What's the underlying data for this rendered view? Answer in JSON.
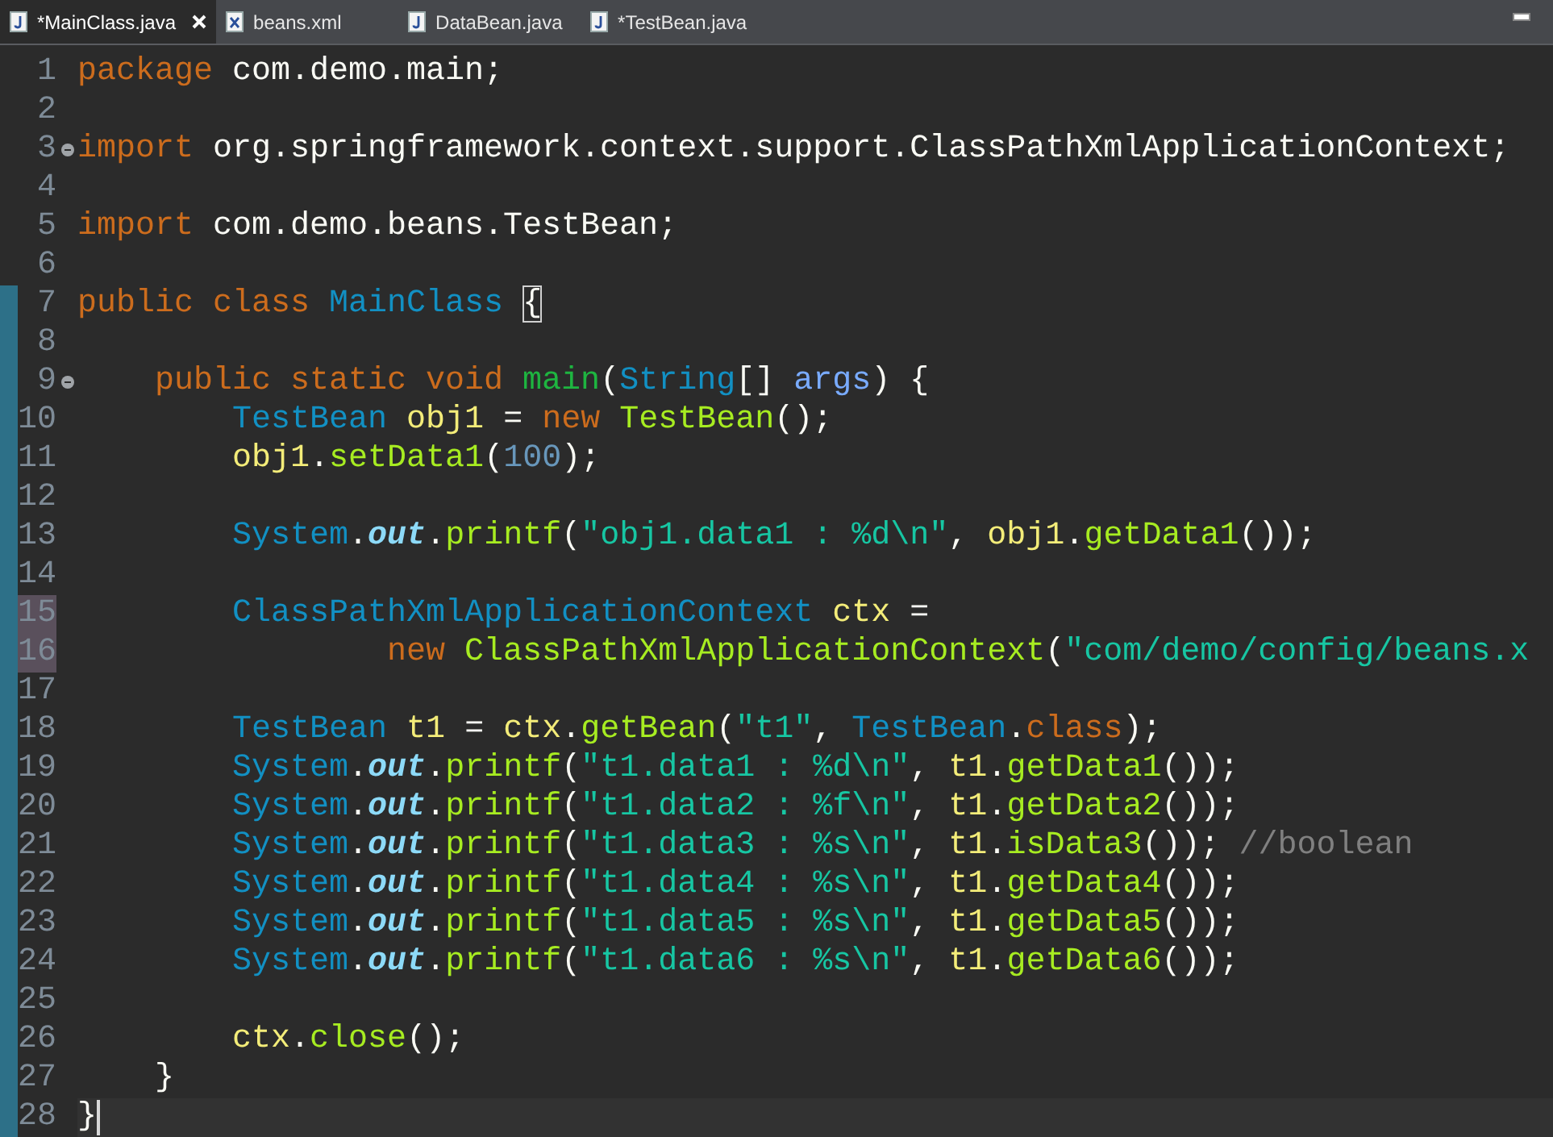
{
  "tabs": [
    {
      "label": "*MainClass.java",
      "kind": "java",
      "selected": true
    },
    {
      "label": "beans.xml",
      "kind": "xml",
      "selected": false
    },
    {
      "label": "DataBean.java",
      "kind": "java",
      "selected": false
    },
    {
      "label": "*TestBean.java",
      "kind": "java",
      "selected": false
    }
  ],
  "editor": {
    "lines": [
      {
        "number": "1",
        "fold": false,
        "selected": false,
        "current": false,
        "changed": false,
        "tokens": [
          {
            "kind": "kw",
            "text": "package "
          },
          {
            "kind": "plain",
            "text": "com.demo.main;"
          }
        ]
      },
      {
        "number": "2",
        "fold": false,
        "selected": false,
        "current": false,
        "changed": false
      },
      {
        "number": "3",
        "fold": true,
        "selected": false,
        "current": false,
        "changed": false,
        "tokens": [
          {
            "kind": "kw",
            "text": "import "
          },
          {
            "kind": "plain",
            "text": "org.springframework.context.support.ClassPathXmlApplicationContext;"
          }
        ]
      },
      {
        "number": "4",
        "fold": false,
        "selected": false,
        "current": false,
        "changed": false
      },
      {
        "number": "5",
        "fold": false,
        "selected": false,
        "current": false,
        "changed": false,
        "tokens": [
          {
            "kind": "kw",
            "text": "import "
          },
          {
            "kind": "plain",
            "text": "com.demo.beans.TestBean;"
          }
        ]
      },
      {
        "number": "6",
        "fold": false,
        "selected": false,
        "current": false,
        "changed": false
      },
      {
        "number": "7",
        "fold": false,
        "selected": false,
        "current": false,
        "changed": true,
        "tokens": [
          {
            "kind": "kw",
            "text": "public class "
          },
          {
            "kind": "type",
            "text": "MainClass "
          },
          {
            "kind": "match",
            "text": "{"
          }
        ]
      },
      {
        "number": "8",
        "fold": false,
        "selected": false,
        "current": false,
        "changed": true
      },
      {
        "number": "9",
        "fold": true,
        "selected": false,
        "current": false,
        "changed": true,
        "tokens": [
          {
            "kind": "kw",
            "text": "    public static void "
          },
          {
            "kind": "decl",
            "text": "main"
          },
          {
            "kind": "plain",
            "text": "("
          },
          {
            "kind": "type",
            "text": "String"
          },
          {
            "kind": "plain",
            "text": "[] "
          },
          {
            "kind": "param",
            "text": "args"
          },
          {
            "kind": "plain",
            "text": ") {"
          }
        ]
      },
      {
        "number": "10",
        "fold": false,
        "selected": false,
        "current": false,
        "changed": true,
        "tokens": [
          {
            "kind": "type",
            "text": "        TestBean "
          },
          {
            "kind": "var",
            "text": "obj1"
          },
          {
            "kind": "plain",
            "text": " = "
          },
          {
            "kind": "kw",
            "text": "new "
          },
          {
            "kind": "method",
            "text": "TestBean"
          },
          {
            "kind": "plain",
            "text": "();"
          }
        ]
      },
      {
        "number": "11",
        "fold": false,
        "selected": false,
        "current": false,
        "changed": true,
        "tokens": [
          {
            "kind": "var",
            "text": "        obj1"
          },
          {
            "kind": "plain",
            "text": "."
          },
          {
            "kind": "method",
            "text": "setData1"
          },
          {
            "kind": "plain",
            "text": "("
          },
          {
            "kind": "num",
            "text": "100"
          },
          {
            "kind": "plain",
            "text": ");"
          }
        ]
      },
      {
        "number": "12",
        "fold": false,
        "selected": false,
        "current": false,
        "changed": true
      },
      {
        "number": "13",
        "fold": false,
        "selected": false,
        "current": false,
        "changed": true,
        "tokens": [
          {
            "kind": "type",
            "text": "        System"
          },
          {
            "kind": "plain",
            "text": "."
          },
          {
            "kind": "field",
            "text": "out"
          },
          {
            "kind": "plain",
            "text": "."
          },
          {
            "kind": "method",
            "text": "printf"
          },
          {
            "kind": "plain",
            "text": "("
          },
          {
            "kind": "str",
            "text": "\"obj1.data1 : %d\\n\""
          },
          {
            "kind": "plain",
            "text": ", "
          },
          {
            "kind": "var",
            "text": "obj1"
          },
          {
            "kind": "plain",
            "text": "."
          },
          {
            "kind": "method",
            "text": "getData1"
          },
          {
            "kind": "plain",
            "text": "());"
          }
        ]
      },
      {
        "number": "14",
        "fold": false,
        "selected": false,
        "current": false,
        "changed": true
      },
      {
        "number": "15",
        "fold": false,
        "selected": true,
        "current": false,
        "changed": true,
        "tokens": [
          {
            "kind": "type",
            "text": "        ClassPathXmlApplicationContext "
          },
          {
            "kind": "var",
            "text": "ctx"
          },
          {
            "kind": "plain",
            "text": " ="
          }
        ]
      },
      {
        "number": "16",
        "fold": false,
        "selected": true,
        "current": false,
        "changed": true,
        "tokens": [
          {
            "kind": "kw",
            "text": "                new "
          },
          {
            "kind": "method",
            "text": "ClassPathXmlApplicationContext"
          },
          {
            "kind": "plain",
            "text": "("
          },
          {
            "kind": "str",
            "text": "\"com/demo/config/beans.x"
          }
        ]
      },
      {
        "number": "17",
        "fold": false,
        "selected": false,
        "current": false,
        "changed": true
      },
      {
        "number": "18",
        "fold": false,
        "selected": false,
        "current": false,
        "changed": true,
        "tokens": [
          {
            "kind": "type",
            "text": "        TestBean "
          },
          {
            "kind": "var",
            "text": "t1"
          },
          {
            "kind": "plain",
            "text": " = "
          },
          {
            "kind": "var",
            "text": "ctx"
          },
          {
            "kind": "plain",
            "text": "."
          },
          {
            "kind": "method",
            "text": "getBean"
          },
          {
            "kind": "plain",
            "text": "("
          },
          {
            "kind": "str",
            "text": "\"t1\""
          },
          {
            "kind": "plain",
            "text": ", "
          },
          {
            "kind": "type",
            "text": "TestBean"
          },
          {
            "kind": "plain",
            "text": "."
          },
          {
            "kind": "kw",
            "text": "class"
          },
          {
            "kind": "plain",
            "text": ");"
          }
        ]
      },
      {
        "number": "19",
        "fold": false,
        "selected": false,
        "current": false,
        "changed": true,
        "tokens": [
          {
            "kind": "type",
            "text": "        System"
          },
          {
            "kind": "plain",
            "text": "."
          },
          {
            "kind": "field",
            "text": "out"
          },
          {
            "kind": "plain",
            "text": "."
          },
          {
            "kind": "method",
            "text": "printf"
          },
          {
            "kind": "plain",
            "text": "("
          },
          {
            "kind": "str",
            "text": "\"t1.data1 : %d\\n\""
          },
          {
            "kind": "plain",
            "text": ", "
          },
          {
            "kind": "var",
            "text": "t1"
          },
          {
            "kind": "plain",
            "text": "."
          },
          {
            "kind": "method",
            "text": "getData1"
          },
          {
            "kind": "plain",
            "text": "());"
          }
        ]
      },
      {
        "number": "20",
        "fold": false,
        "selected": false,
        "current": false,
        "changed": true,
        "tokens": [
          {
            "kind": "type",
            "text": "        System"
          },
          {
            "kind": "plain",
            "text": "."
          },
          {
            "kind": "field",
            "text": "out"
          },
          {
            "kind": "plain",
            "text": "."
          },
          {
            "kind": "method",
            "text": "printf"
          },
          {
            "kind": "plain",
            "text": "("
          },
          {
            "kind": "str",
            "text": "\"t1.data2 : %f\\n\""
          },
          {
            "kind": "plain",
            "text": ", "
          },
          {
            "kind": "var",
            "text": "t1"
          },
          {
            "kind": "plain",
            "text": "."
          },
          {
            "kind": "method",
            "text": "getData2"
          },
          {
            "kind": "plain",
            "text": "());"
          }
        ]
      },
      {
        "number": "21",
        "fold": false,
        "selected": false,
        "current": false,
        "changed": true,
        "tokens": [
          {
            "kind": "type",
            "text": "        System"
          },
          {
            "kind": "plain",
            "text": "."
          },
          {
            "kind": "field",
            "text": "out"
          },
          {
            "kind": "plain",
            "text": "."
          },
          {
            "kind": "method",
            "text": "printf"
          },
          {
            "kind": "plain",
            "text": "("
          },
          {
            "kind": "str",
            "text": "\"t1.data3 : %s\\n\""
          },
          {
            "kind": "plain",
            "text": ", "
          },
          {
            "kind": "var",
            "text": "t1"
          },
          {
            "kind": "plain",
            "text": "."
          },
          {
            "kind": "method",
            "text": "isData3"
          },
          {
            "kind": "plain",
            "text": "()); "
          },
          {
            "kind": "comment",
            "text": "//boolean"
          }
        ]
      },
      {
        "number": "22",
        "fold": false,
        "selected": false,
        "current": false,
        "changed": true,
        "tokens": [
          {
            "kind": "type",
            "text": "        System"
          },
          {
            "kind": "plain",
            "text": "."
          },
          {
            "kind": "field",
            "text": "out"
          },
          {
            "kind": "plain",
            "text": "."
          },
          {
            "kind": "method",
            "text": "printf"
          },
          {
            "kind": "plain",
            "text": "("
          },
          {
            "kind": "str",
            "text": "\"t1.data4 : %s\\n\""
          },
          {
            "kind": "plain",
            "text": ", "
          },
          {
            "kind": "var",
            "text": "t1"
          },
          {
            "kind": "plain",
            "text": "."
          },
          {
            "kind": "method",
            "text": "getData4"
          },
          {
            "kind": "plain",
            "text": "());"
          }
        ]
      },
      {
        "number": "23",
        "fold": false,
        "selected": false,
        "current": false,
        "changed": true,
        "tokens": [
          {
            "kind": "type",
            "text": "        System"
          },
          {
            "kind": "plain",
            "text": "."
          },
          {
            "kind": "field",
            "text": "out"
          },
          {
            "kind": "plain",
            "text": "."
          },
          {
            "kind": "method",
            "text": "printf"
          },
          {
            "kind": "plain",
            "text": "("
          },
          {
            "kind": "str",
            "text": "\"t1.data5 : %s\\n\""
          },
          {
            "kind": "plain",
            "text": ", "
          },
          {
            "kind": "var",
            "text": "t1"
          },
          {
            "kind": "plain",
            "text": "."
          },
          {
            "kind": "method",
            "text": "getData5"
          },
          {
            "kind": "plain",
            "text": "());"
          }
        ]
      },
      {
        "number": "24",
        "fold": false,
        "selected": false,
        "current": false,
        "changed": true,
        "tokens": [
          {
            "kind": "type",
            "text": "        System"
          },
          {
            "kind": "plain",
            "text": "."
          },
          {
            "kind": "field",
            "text": "out"
          },
          {
            "kind": "plain",
            "text": "."
          },
          {
            "kind": "method",
            "text": "printf"
          },
          {
            "kind": "plain",
            "text": "("
          },
          {
            "kind": "str",
            "text": "\"t1.data6 : %s\\n\""
          },
          {
            "kind": "plain",
            "text": ", "
          },
          {
            "kind": "var",
            "text": "t1"
          },
          {
            "kind": "plain",
            "text": "."
          },
          {
            "kind": "method",
            "text": "getData6"
          },
          {
            "kind": "plain",
            "text": "());"
          }
        ]
      },
      {
        "number": "25",
        "fold": false,
        "selected": false,
        "current": false,
        "changed": true
      },
      {
        "number": "26",
        "fold": false,
        "selected": false,
        "current": false,
        "changed": true,
        "tokens": [
          {
            "kind": "var",
            "text": "        ctx"
          },
          {
            "kind": "plain",
            "text": "."
          },
          {
            "kind": "method",
            "text": "close"
          },
          {
            "kind": "plain",
            "text": "();"
          }
        ]
      },
      {
        "number": "27",
        "fold": false,
        "selected": false,
        "current": false,
        "changed": true,
        "tokens": [
          {
            "kind": "plain",
            "text": "    }"
          }
        ]
      },
      {
        "number": "28",
        "fold": false,
        "selected": false,
        "current": true,
        "changed": true,
        "tokens": [
          {
            "kind": "plain",
            "text": "}"
          }
        ]
      }
    ]
  }
}
